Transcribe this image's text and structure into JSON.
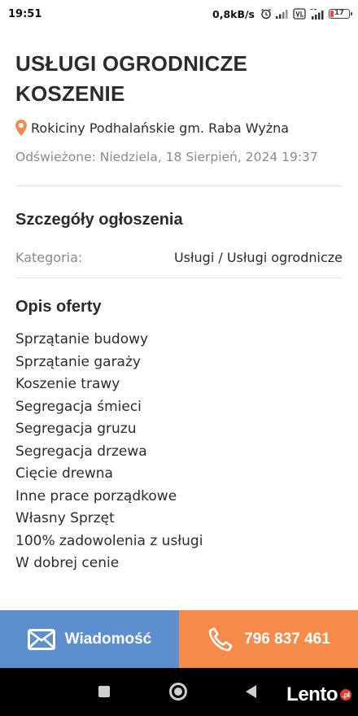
{
  "status_bar": {
    "time": "19:51",
    "speed": "0,8kB/s",
    "battery": "17"
  },
  "listing": {
    "title_line1": "USŁUGI OGRODNICZE",
    "title_line2": "KOSZENIE",
    "location": "Rokiciny Podhalańskie gm. Raba Wyżna",
    "refreshed": "Odświeżone: Niedziela, 18 Sierpień, 2024  19:37"
  },
  "details": {
    "heading": "Szczegóły ogłoszenia",
    "category_label": "Kategoria:",
    "category_value": "Usługi / Usługi ogrodnicze"
  },
  "offer": {
    "heading": "Opis oferty",
    "lines": [
      "Sprzątanie budowy",
      "Sprzątanie garaży",
      "Koszenie trawy",
      "Segregacja śmieci",
      "Segregacja gruzu",
      "Segregacja drzewa",
      "Cięcie drewna",
      "Inne prace porządkowe",
      "Własny Sprzęt",
      "100% zadowolenia z usługi",
      "W dobrej cenie"
    ]
  },
  "actions": {
    "message_label": "Wiadomość",
    "phone_label": "796 837 461"
  },
  "brand": {
    "logo_text": "Lento",
    "logo_badge": ".pl"
  },
  "colors": {
    "message_button": "#5d8fcf",
    "call_button": "#f58a4b",
    "pin": "#f58a4b"
  },
  "icons": {
    "location": "map-pin-icon",
    "message": "envelope-icon",
    "phone": "phone-icon"
  }
}
